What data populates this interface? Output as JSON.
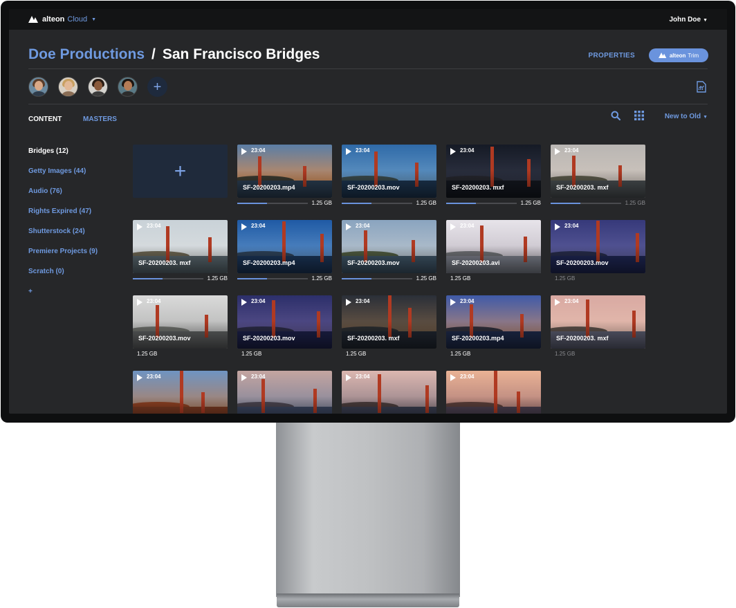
{
  "app": {
    "logo_text": "alteon",
    "product": "Cloud"
  },
  "user": {
    "name": "John Doe"
  },
  "breadcrumb": {
    "root": "Doe Productions",
    "separator": "/",
    "current": "San Francisco Bridges"
  },
  "header": {
    "properties_label": "PROPERTIES",
    "trim_brand": "alteon",
    "trim_label": "Trim"
  },
  "tabs": [
    {
      "label": "CONTENT",
      "active": true
    },
    {
      "label": "MASTERS",
      "active": false
    }
  ],
  "sort": {
    "label": "New to Old"
  },
  "sidebar": {
    "items": [
      {
        "label": "Bridges (12)",
        "active": true
      },
      {
        "label": "Getty Images (44)"
      },
      {
        "label": "Audio (76)"
      },
      {
        "label": "Rights Expired (47)"
      },
      {
        "label": "Shutterstock (24)"
      },
      {
        "label": "Premiere Projects (9)"
      },
      {
        "label": "Scratch (0)"
      },
      {
        "label": "+"
      }
    ]
  },
  "add_card": {
    "symbol": "+"
  },
  "assets": [
    {
      "duration": "23:04",
      "name": "SF-20200203.mp4",
      "size": "1.25 GB",
      "progress": 0.42
    },
    {
      "duration": "23:04",
      "name": "SF-20200203.mov",
      "size": "1.25 GB",
      "progress": 0.42
    },
    {
      "duration": "23:04",
      "name": "SF-20200203. mxf",
      "size": "1.25 GB",
      "progress": 0.42
    },
    {
      "duration": "23:04",
      "name": "SF-20200203. mxf",
      "size": "1.25 GB",
      "progress": 0.42
    },
    {
      "duration": "23:04",
      "name": "SF-20200203. mxf",
      "size": "1.25 GB",
      "progress": 0.42
    },
    {
      "duration": "23:04",
      "name": "SF-20200203.mp4",
      "size": "1.25 GB",
      "progress": 0.42
    },
    {
      "duration": "23:04",
      "name": "SF-20200203.mov",
      "size": "1.25 GB",
      "progress": 0.42
    },
    {
      "duration": "23:04",
      "name": "SF-20200203.avi",
      "size": "1.25 GB"
    },
    {
      "duration": "23:04",
      "name": "SF-20200203.mov",
      "size": "1.25 GB"
    },
    {
      "duration": "23:04",
      "name": "SF-20200203.mov",
      "size": "1.25 GB"
    },
    {
      "duration": "23:04",
      "name": "SF-20200203.mov",
      "size": "1.25 GB"
    },
    {
      "duration": "23:04",
      "name": "SF-20200203. mxf",
      "size": "1.25 GB"
    },
    {
      "duration": "23:04",
      "name": "SF-20200203.mp4",
      "size": "1.25 GB"
    },
    {
      "duration": "23:04",
      "name": "SF-20200203. mxf",
      "size": "1.25 GB"
    },
    {
      "duration": "23:04"
    },
    {
      "duration": "23:04"
    },
    {
      "duration": "23:04"
    },
    {
      "duration": "23:04"
    }
  ]
}
